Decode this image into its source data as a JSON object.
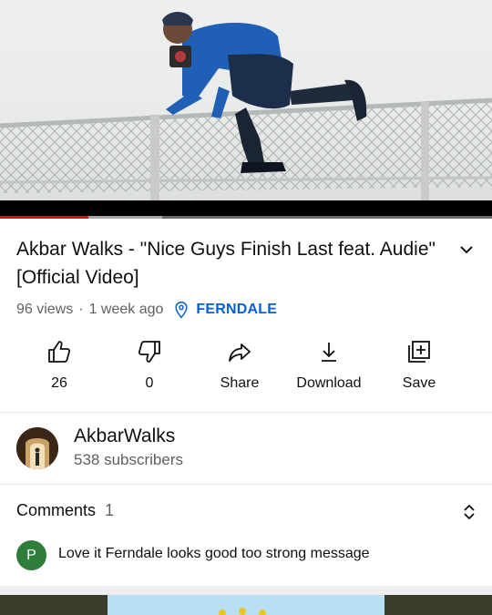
{
  "video": {
    "title": "Akbar Walks - \"Nice Guys Finish Last feat. Audie\" [Official Video]",
    "views": "96 views",
    "separator": "·",
    "age": "1 week ago",
    "location": "FERNDALE",
    "progress_fraction": 0.18,
    "buffered_fraction": 0.33
  },
  "actions": {
    "like_count": "26",
    "dislike_count": "0",
    "share_label": "Share",
    "download_label": "Download",
    "save_label": "Save"
  },
  "channel": {
    "name": "AkbarWalks",
    "subscribers": "538 subscribers"
  },
  "comments": {
    "heading": "Comments",
    "count": "1",
    "first": {
      "avatar_letter": "P",
      "text": "Love it Ferndale looks good too strong message"
    }
  },
  "icons": {
    "expand": "chevron-down-icon",
    "location": "location-pin-icon",
    "like": "thumb-up-icon",
    "dislike": "thumb-down-icon",
    "share": "share-arrow-icon",
    "download": "download-icon",
    "save": "add-to-playlist-icon",
    "sort": "expand-collapse-icon"
  },
  "colors": {
    "progress": "#ff0000",
    "location_link": "#065fd4",
    "comment_avatar": "#2f7d3a"
  }
}
